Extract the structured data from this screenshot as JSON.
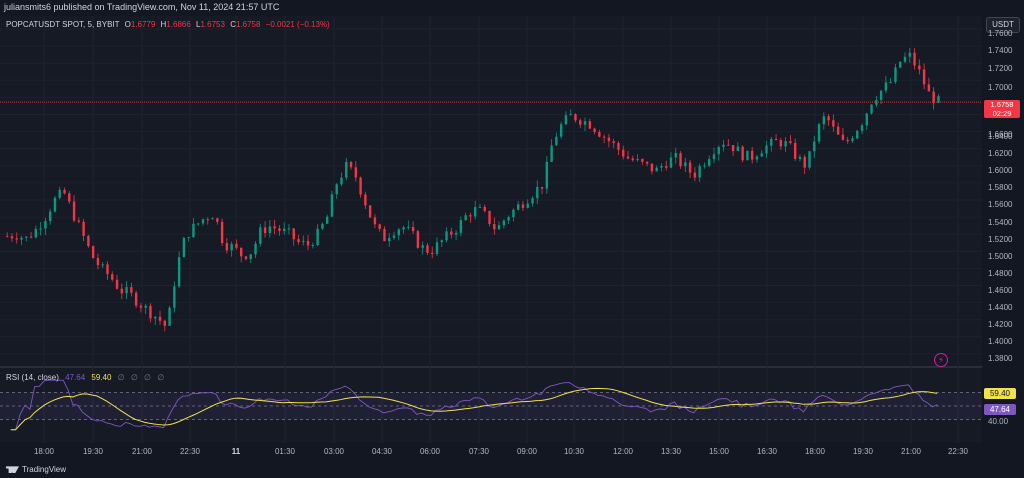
{
  "publisher_text": "juliansmits6 published on TradingView.com, Nov 11, 2024 21:57 UTC",
  "legend": {
    "symbol": "POPCATUSDT SPOT, 5, BYBIT",
    "o_label": "O",
    "o_value": "1.6779",
    "h_label": "H",
    "h_value": "1.6866",
    "l_label": "L",
    "l_value": "1.6753",
    "c_label": "C",
    "c_value": "1.6758",
    "change": "−0.0021 (−0.13%)"
  },
  "currency_button": "USDT",
  "price_axis": {
    "ticks": [
      "1.7600",
      "1.7400",
      "1.7200",
      "1.7000",
      "1.6600",
      "1.6400",
      "1.6200",
      "1.6000",
      "1.5800",
      "1.5600",
      "1.5400",
      "1.5200",
      "1.5000",
      "1.4800",
      "1.4600",
      "1.4400",
      "1.4200",
      "1.4000",
      "1.3800"
    ],
    "ylim": [
      1.37,
      1.77
    ]
  },
  "last_price": {
    "value": "1.6758",
    "countdown": "02:29"
  },
  "rsi": {
    "label": "RSI (14, close)",
    "value_rsi": "47.64",
    "value_ma": "59.40",
    "dots": "∅ ∅ ∅ ∅",
    "axis_label": "40.00"
  },
  "time_axis": [
    "18:00",
    "19:30",
    "21:00",
    "22:30",
    "11",
    "01:30",
    "03:00",
    "04:30",
    "06:00",
    "07:30",
    "09:00",
    "10:30",
    "12:00",
    "13:30",
    "15:00",
    "16:30",
    "18:00",
    "19:30",
    "21:00",
    "22:30"
  ],
  "footer_brand": "TradingView",
  "colors": {
    "up": "#089981",
    "down": "#f23645",
    "rsi": "#7e57c2",
    "rsi_ma": "#f0e24c",
    "bg": "#131722"
  },
  "chart_data": {
    "type": "candlestick",
    "price_path": [
      1.518,
      1.52,
      1.515,
      1.525,
      1.54,
      1.56,
      1.57,
      1.545,
      1.52,
      1.495,
      1.48,
      1.47,
      1.455,
      1.45,
      1.44,
      1.43,
      1.422,
      1.41,
      1.48,
      1.52,
      1.53,
      1.54,
      1.545,
      1.51,
      1.505,
      1.495,
      1.5,
      1.525,
      1.53,
      1.525,
      1.52,
      1.51,
      1.508,
      1.52,
      1.54,
      1.58,
      1.6,
      1.59,
      1.56,
      1.53,
      1.515,
      1.525,
      1.53,
      1.52,
      1.505,
      1.5,
      1.51,
      1.52,
      1.53,
      1.545,
      1.55,
      1.54,
      1.525,
      1.54,
      1.55,
      1.56,
      1.57,
      1.58,
      1.63,
      1.65,
      1.66,
      1.655,
      1.65,
      1.64,
      1.63,
      1.62,
      1.61,
      1.605,
      1.6,
      1.595,
      1.605,
      1.61,
      1.6,
      1.59,
      1.605,
      1.62,
      1.63,
      1.625,
      1.615,
      1.61,
      1.62,
      1.625,
      1.63,
      1.625,
      1.61,
      1.6,
      1.64,
      1.66,
      1.64,
      1.625,
      1.64,
      1.655,
      1.68,
      1.69,
      1.7,
      1.725,
      1.73,
      1.71,
      1.685,
      1.676
    ]
  }
}
